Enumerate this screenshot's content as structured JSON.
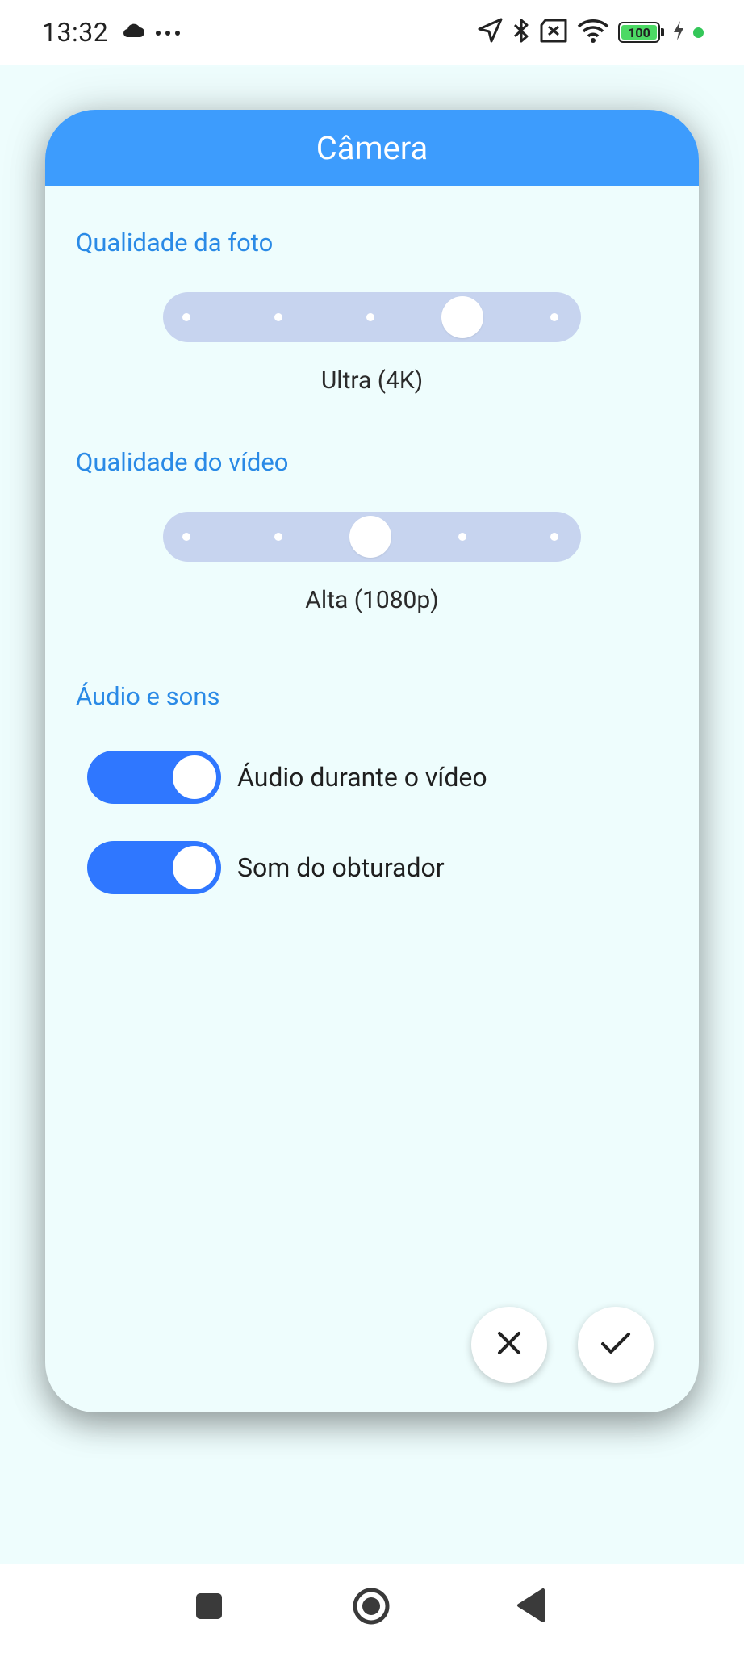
{
  "status_bar": {
    "time": "13:32",
    "battery_level": "100",
    "icons": [
      "cloud-icon",
      "more-dots-icon",
      "location-arrow-icon",
      "bluetooth-icon",
      "sim-x-icon",
      "wifi-icon",
      "battery-icon",
      "charging-bolt-icon",
      "green-dot-indicator"
    ]
  },
  "dialog": {
    "title": "Câmera",
    "photo_quality": {
      "section_title": "Qualidade da foto",
      "value_label": "Ultra (4K)",
      "steps": 5,
      "selected_step": 4
    },
    "video_quality": {
      "section_title": "Qualidade do vídeo",
      "value_label": "Alta (1080p)",
      "steps": 5,
      "selected_step": 3
    },
    "audio": {
      "section_title": "Áudio e sons",
      "toggles": [
        {
          "label": "Áudio durante o vídeo",
          "on": true
        },
        {
          "label": "Som do obturador",
          "on": true
        }
      ]
    },
    "actions": {
      "cancel_icon": "close-icon",
      "confirm_icon": "check-icon"
    }
  },
  "nav_bar": {
    "icons": [
      "recents-square-icon",
      "home-circle-icon",
      "back-triangle-icon"
    ]
  },
  "colors": {
    "header": "#3d9cfd",
    "section_title": "#2a8ae6",
    "slider_track": "#c7d4ef",
    "toggle_on": "#2f77ff",
    "background": "#eefdfd"
  }
}
